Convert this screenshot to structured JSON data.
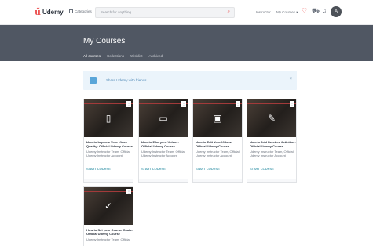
{
  "header": {
    "brand": "Udemy",
    "categories_label": "Categories",
    "search_placeholder": "Search for anything",
    "instructor_label": "Instructor",
    "my_courses_label": "My Courses",
    "avatar_initial": "A"
  },
  "banner": {
    "title": "My Courses",
    "tabs": [
      {
        "label": "All courses",
        "active": true
      },
      {
        "label": "Collections",
        "active": false
      },
      {
        "label": "Wishlist",
        "active": false
      },
      {
        "label": "Archived",
        "active": false
      }
    ]
  },
  "share": {
    "text": "Share Udemy with friends",
    "close": "×"
  },
  "courses": [
    {
      "title": "How to Improve Your Video Quality: Official Udemy Course",
      "author": "Udemy Instructor Team, Official Udemy Instructor Account",
      "action": "START COURSE",
      "icon": "phone-icon"
    },
    {
      "title": "How to Film your Videos: Official Udemy Course",
      "author": "Udemy Instructor Team, Official Udemy Instructor Account",
      "action": "START COURSE",
      "icon": "camera-icon"
    },
    {
      "title": "How to Edit Your Videos: Official Udemy Course",
      "author": "Udemy Instructor Team, Official Udemy Instructor Account",
      "action": "START COURSE",
      "icon": "monitor-icon"
    },
    {
      "title": "How to Add Practice Activities: Official Udemy Course",
      "author": "Udemy Instructor Team, Official Udemy Instructor Account",
      "action": "START COURSE",
      "icon": "document-icon"
    },
    {
      "title": "How to Set your Course Goals: Official Udemy Course",
      "author": "Udemy Instructor Team, Official",
      "action": "",
      "icon": "checklist-icon"
    }
  ],
  "colors": {
    "brand": "#ec5252",
    "banner": "#505763",
    "link": "#007791",
    "share_bg": "#ebf4fb"
  }
}
